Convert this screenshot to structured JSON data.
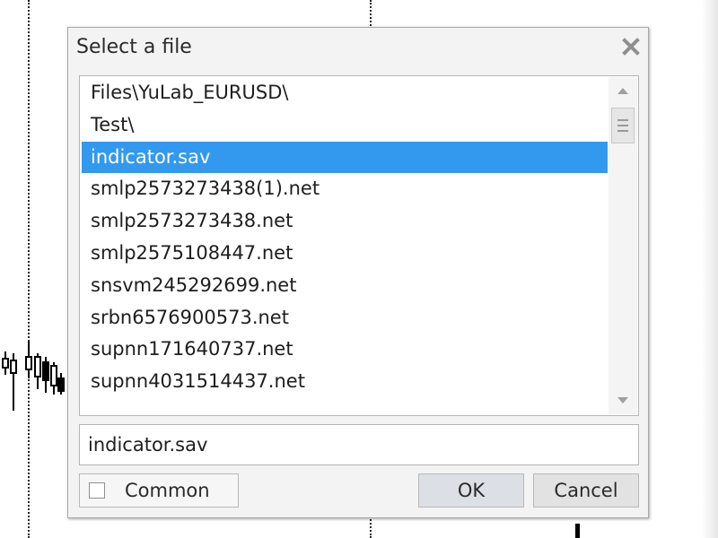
{
  "dialog": {
    "title": "Select a file",
    "close_icon": "close-x-icon"
  },
  "file_list": {
    "items": [
      {
        "label": "Files\\YuLab_EURUSD\\",
        "selected": false
      },
      {
        "label": "Test\\",
        "selected": false
      },
      {
        "label": "indicator.sav",
        "selected": true
      },
      {
        "label": "smlp2573273438(1).net",
        "selected": false
      },
      {
        "label": "smlp2573273438.net",
        "selected": false
      },
      {
        "label": "smlp2575108447.net",
        "selected": false
      },
      {
        "label": "snsvm245292699.net",
        "selected": false
      },
      {
        "label": "srbn6576900573.net",
        "selected": false
      },
      {
        "label": "supnn171640737.net",
        "selected": false
      },
      {
        "label": "supnn4031514437.net",
        "selected": false
      }
    ],
    "scroll_up_icon": "triangle-up-icon",
    "scroll_down_icon": "triangle-down-icon"
  },
  "filename": {
    "value": "indicator.sav"
  },
  "common": {
    "label": "Common",
    "checked": false
  },
  "buttons": {
    "ok": "OK",
    "cancel": "Cancel"
  },
  "colors": {
    "selection": "#3399ee",
    "dialog_bg": "#f3f3f3"
  }
}
